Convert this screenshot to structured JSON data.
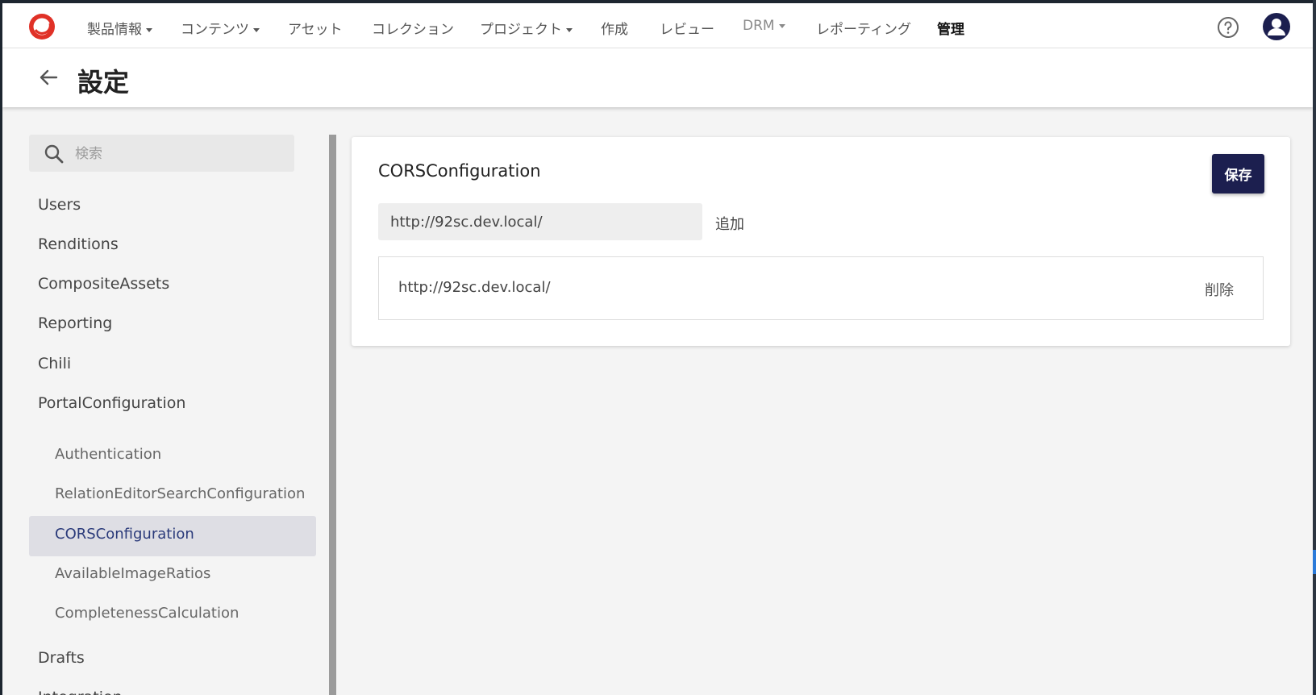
{
  "nav": {
    "items": [
      {
        "label": "製品情報",
        "dropdown": true
      },
      {
        "label": "コンテンツ",
        "dropdown": true
      },
      {
        "label": "アセット",
        "dropdown": false
      },
      {
        "label": "コレクション",
        "dropdown": false
      },
      {
        "label": "プロジェクト",
        "dropdown": true
      },
      {
        "label": "作成",
        "dropdown": false
      },
      {
        "label": "レビュー",
        "dropdown": false
      },
      {
        "label": "DRM",
        "dropdown": true
      },
      {
        "label": "レポーティング",
        "dropdown": false
      },
      {
        "label": "管理",
        "dropdown": false,
        "active": true
      }
    ],
    "help_icon": "help-circle-icon",
    "avatar_icon": "user-avatar-icon",
    "brand_color": "#e03127"
  },
  "header": {
    "title": "設定",
    "back_icon": "arrow-left-icon"
  },
  "sidebar": {
    "search_placeholder": "検索",
    "items": [
      {
        "label": "Users"
      },
      {
        "label": "Renditions"
      },
      {
        "label": "CompositeAssets"
      },
      {
        "label": "Reporting"
      },
      {
        "label": "Chili"
      },
      {
        "label": "PortalConfiguration"
      },
      {
        "label": "Drafts"
      },
      {
        "label": "Integration"
      }
    ],
    "subitems": [
      {
        "label": "Authentication"
      },
      {
        "label": "RelationEditorSearchConfiguration"
      },
      {
        "label": "CORSConfiguration",
        "selected": true
      },
      {
        "label": "AvailableImageRatios"
      },
      {
        "label": "CompletenessCalculation"
      }
    ]
  },
  "main": {
    "card_title": "CORSConfiguration",
    "save_label": "保存",
    "input_value": "http://92sc.dev.local/",
    "add_label": "追加",
    "entries": [
      {
        "url": "http://92sc.dev.local/",
        "delete_label": "削除"
      }
    ],
    "accent_color": "#1c1f4f"
  }
}
